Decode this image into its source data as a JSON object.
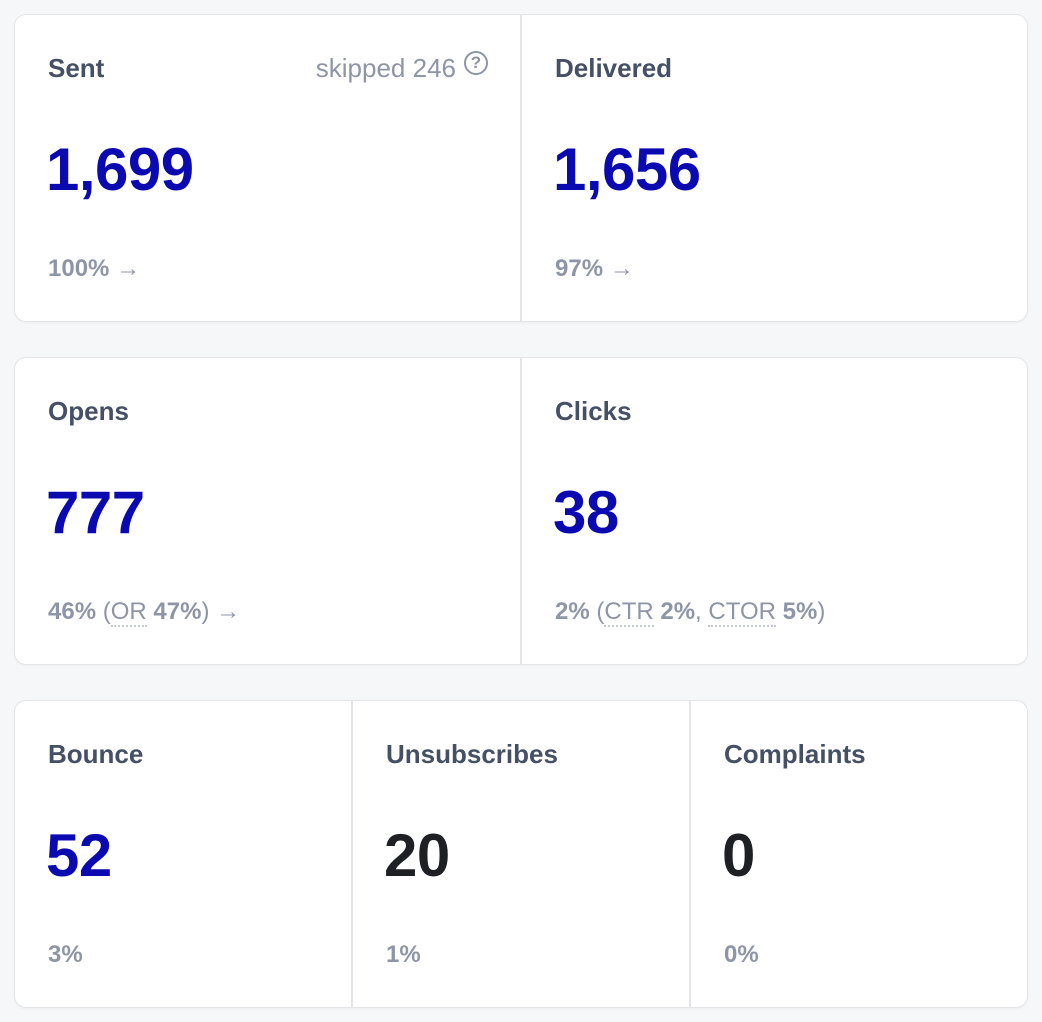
{
  "row1": [
    {
      "label": "Sent",
      "value": "1,699",
      "pct": "100%",
      "arrow": "→",
      "skipped_text": "skipped 246"
    },
    {
      "label": "Delivered",
      "value": "1,656",
      "pct": "97%",
      "arrow": "→"
    }
  ],
  "row2": [
    {
      "label": "Opens",
      "value": "777",
      "pct": "46%",
      "paren_open": "(",
      "metric": "OR",
      "metric_value": "47%",
      "paren_close": ")",
      "arrow": "→"
    },
    {
      "label": "Clicks",
      "value": "38",
      "pct": "2%",
      "paren_open": "(",
      "metric1": "CTR",
      "metric1_value": "2%",
      "comma": ",",
      "metric2": "CTOR",
      "metric2_value": "5%",
      "paren_close": ")"
    }
  ],
  "row3": [
    {
      "label": "Bounce",
      "value": "52",
      "pct": "3%"
    },
    {
      "label": "Unsubscribes",
      "value": "20",
      "pct": "1%"
    },
    {
      "label": "Complaints",
      "value": "0",
      "pct": "0%"
    }
  ],
  "colors": {
    "accent": "#0a0ab0",
    "muted": "#8e95a5",
    "label": "#465064",
    "neutral": "#1f2023"
  },
  "icons": {
    "help": "question-circle-icon",
    "arrow": "arrow-right-icon"
  }
}
